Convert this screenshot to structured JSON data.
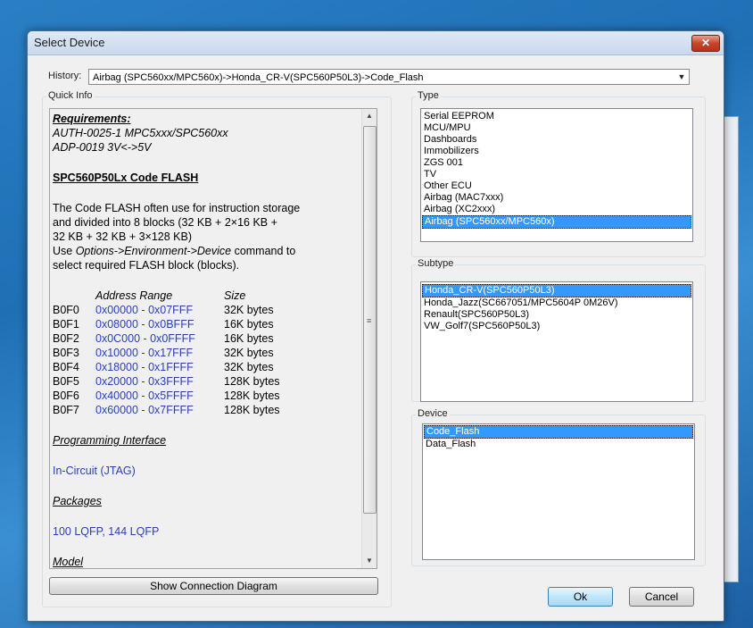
{
  "window": {
    "title": "Select Device",
    "close_glyph": "✕"
  },
  "history": {
    "label": "History:",
    "value": "Airbag (SPC560xx/MPC560x)->Honda_CR-V(SPC560P50L3)->Code_Flash"
  },
  "quick_info": {
    "label": "Quick Info",
    "requirements_title": "Requirements:",
    "requirements": [
      "AUTH-0025-1 MPC5xxx/SPC560xx",
      "ADP-0019 3V<->5V"
    ],
    "heading": "SPC560P50Lx Code FLASH",
    "desc_lines": [
      "The Code FLASH often use for instruction storage",
      "and divided into 8 blocks (32 KB + 2×16 KB +",
      "32 KB + 32 KB + 3×128 KB)"
    ],
    "use_prefix": "Use ",
    "use_cmd": "Options->Environment->Device",
    "use_suffix": " command to",
    "use_line2": "select required FLASH block (blocks).",
    "table_headers": {
      "range": "Address Range",
      "size": "Size"
    },
    "blocks": [
      {
        "name": "B0F0",
        "range": "0x00000 - 0x07FFF",
        "size": "32K bytes"
      },
      {
        "name": "B0F1",
        "range": "0x08000 - 0x0BFFF",
        "size": "16K bytes"
      },
      {
        "name": "B0F2",
        "range": "0x0C000 - 0x0FFFF",
        "size": "16K bytes"
      },
      {
        "name": "B0F3",
        "range": "0x10000 - 0x17FFF",
        "size": "32K bytes"
      },
      {
        "name": "B0F4",
        "range": "0x18000 - 0x1FFFF",
        "size": "32K bytes"
      },
      {
        "name": "B0F5",
        "range": "0x20000 - 0x3FFFF",
        "size": "128K bytes"
      },
      {
        "name": "B0F6",
        "range": "0x40000 - 0x5FFFF",
        "size": "128K bytes"
      },
      {
        "name": "B0F7",
        "range": "0x60000 - 0x7FFFF",
        "size": "128K bytes"
      }
    ],
    "programming_interface_title": "Programming Interface",
    "programming_interface": "In-Circuit (JTAG)",
    "packages_title": "Packages",
    "packages": "100 LQFP, 144 LQFP",
    "model_title": "Model",
    "scroll_up": "▲",
    "scroll_down": "▼",
    "scroll_grip": "≡"
  },
  "show_diagram_button": "Show Connection Diagram",
  "type_group": {
    "label": "Type",
    "items": [
      "Serial EEPROM",
      "MCU/MPU",
      "Dashboards",
      "Immobilizers",
      "ZGS 001",
      "TV",
      "Other ECU",
      "Airbag (MAC7xxx)",
      "Airbag (XC2xxx)",
      "Airbag (SPC560xx/MPC560x)"
    ],
    "selected_index": 9
  },
  "subtype_group": {
    "label": "Subtype",
    "items": [
      "Honda_CR-V(SPC560P50L3)",
      "Honda_Jazz(SC667051/MPC5604P 0M26V)",
      "Renault(SPC560P50L3)",
      "VW_Golf7(SPC560P50L3)"
    ],
    "selected_index": 0
  },
  "device_group": {
    "label": "Device",
    "items": [
      "Code_Flash",
      "Data_Flash"
    ],
    "selected_index": 0
  },
  "buttons": {
    "ok": "Ok",
    "cancel": "Cancel"
  },
  "dropdown_arrow": "▼",
  "colors": {
    "selection": "#3399ff",
    "link_blue": "#2a3fb5",
    "close_red": "#c7452a"
  }
}
